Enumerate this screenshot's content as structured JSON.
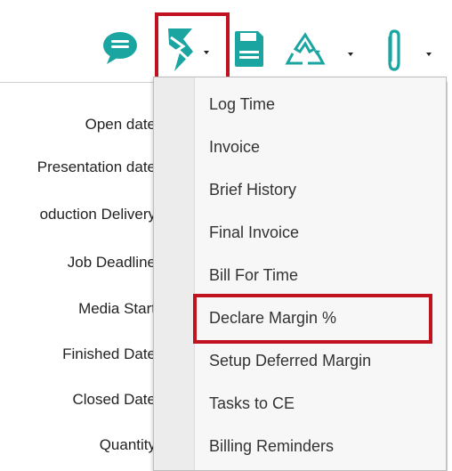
{
  "toolbar": {
    "icons": [
      "chat-icon",
      "billing-icon",
      "save-icon",
      "recycle-icon",
      "paperclip-icon"
    ],
    "colors": {
      "teal": "#1ba5a1",
      "highlight": "#c1121f"
    }
  },
  "form": {
    "labels": [
      "Open date",
      "Presentation date",
      "oduction Delivery",
      "Job Deadline",
      "Media Start",
      "Finished Date",
      "Closed Date",
      "Quantity"
    ]
  },
  "menu": {
    "items": [
      "Log Time",
      "Invoice",
      "Brief History",
      "Final Invoice",
      "Bill For Time",
      "Declare Margin %",
      "Setup Deferred Margin",
      "Tasks to CE",
      "Billing Reminders"
    ],
    "highlighted_item": "Declare Margin %"
  }
}
